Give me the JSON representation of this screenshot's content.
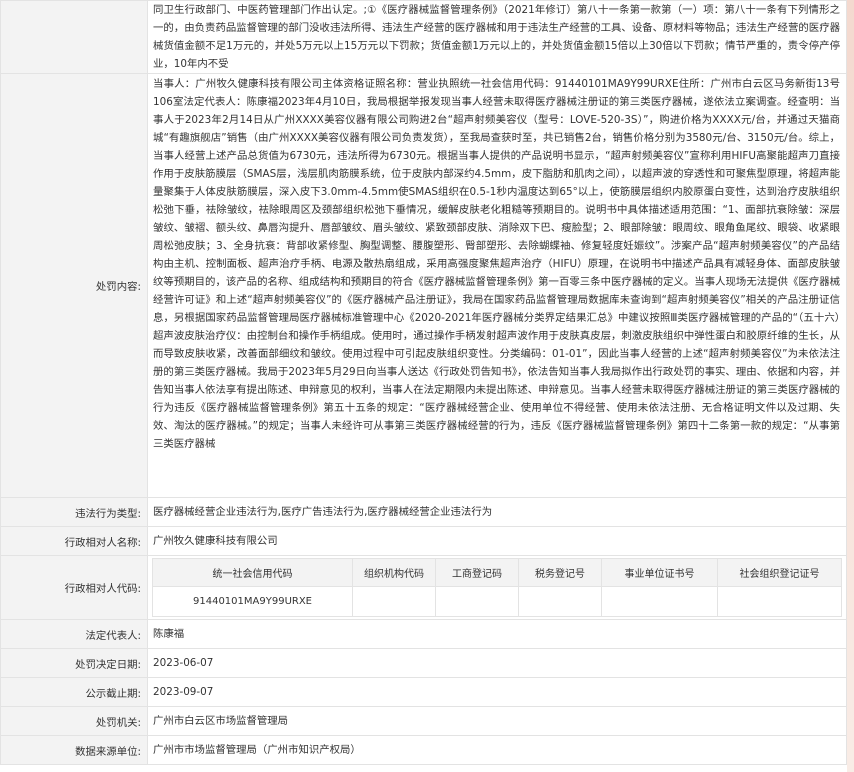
{
  "record": {
    "top_continuation": "同卫生行政部门、中医药管理部门作出认定。;①《医疗器械监督管理条例》（2021年修订）第八十一条第一款第（一）项：第八十一条有下列情形之一的，由负责药品监督管理的部门没收违法所得、违法生产经营的医疗器械和用于违法生产经营的工具、设备、原材料等物品；违法生产经营的医疗器械货值金额不足1万元的，并处5万元以上15万元以下罚款；货值金额1万元以上的，并处货值金额15倍以上30倍以下罚款；情节严重的，责令停产停业，10年内不受",
    "content_label": "处罚内容:",
    "content_text": "当事人：广州牧久健康科技有限公司主体资格证照名称：营业执照统一社会信用代码：91440101MA9Y99URXE住所：广州市白云区马务新街13号106室法定代表人：陈康福2023年4月10日，我局根据举报发现当事人经营未取得医疗器械注册证的第三类医疗器械，遂依法立案调查。经查明：当事人于2023年2月14日从广州XXXX美容仪器有限公司购进2台“超声射频美容仪（型号：LOVE-520-3S）”，购进价格为XXXX元/台，并通过天猫商城“有趣旗舰店”销售（由广州XXXX美容仪器有限公司负责发货），至我局查获时至，共已销售2台，销售价格分别为3580元/台、3150元/台。综上，当事人经营上述产品总货值为6730元，违法所得为6730元。根据当事人提供的产品说明书显示，“超声射频美容仪”宣称利用HIFU高聚能超声刀直接作用于皮肤筋膜层（SMAS层，浅层肌肉筋膜系统，位于皮肤内部深约4.5mm，皮下脂肪和肌肉之间），以超声波的穿透性和可聚焦型原理，将超声能量聚集于人体皮肤筋膜层，深入皮下3.0mm-4.5mm使SMAS组织在0.5-1秒内温度达到65°以上，使筋膜层组织内胶原蛋白变性，达到治疗皮肤组织松弛下垂，祛除皱纹，祛除眼周区及颈部组织松弛下垂情况，缓解皮肤老化粗糙等预期目的。说明书中具体描述适用范围：“1、面部抗衰除皱：深层皱纹、皱褶、额头纹、鼻唇沟提升、唇部皱纹、眉头皱纹、紧致颈部皮肤、消除双下巴、瘦脸型；2、眼部除皱：眼周纹、眼角鱼尾纹、眼袋、收紧眼周松弛皮肤；3、全身抗衰：背部收紧修型、胸型调整、腰腹塑形、臀部塑形、去除蝴蝶袖、修复轻度妊娠纹”。涉案产品“超声射频美容仪”的产品结构由主机、控制面板、超声治疗手柄、电源及散热扇组成，采用高强度聚焦超声治疗（HIFU）原理，在说明书中描述产品具有减轻身体、面部皮肤皱纹等预期目的，该产品的名称、组成结构和预期目的符合《医疗器械监督管理条例》第一百零三条中医疗器械的定义。当事人现场无法提供《医疗器械经营许可证》和上述“超声射频美容仪”的《医疗器械产品注册证》，我局在国家药品监督管理局数据库未查询到“超声射频美容仪”相关的产品注册证信息，另根据国家药品监督管理局医疗器械标准管理中心《2020-2021年医疗器械分类界定结果汇总》中建议按照Ⅲ类医疗器械管理的产品的“（五十六）超声波皮肤治疗仪：由控制台和操作手柄组成。使用时，通过操作手柄发射超声波作用于皮肤真皮层，刺激皮肤组织中弹性蛋白和胶原纤维的生长，从而导致皮肤收紧，改善面部细纹和皱纹。使用过程中可引起皮肤组织变性。分类编码：01-01”，因此当事人经营的上述“超声射频美容仪”为未依法注册的第三类医疗器械。我局于2023年5月29日向当事人送达《行政处罚告知书》，依法告知当事人我局拟作出行政处罚的事实、理由、依据和内容，并告知当事人依法享有提出陈述、申辩意见的权利，当事人在法定期限内未提出陈述、申辩意见。当事人经营未取得医疗器械注册证的第三类医疗器械的行为违反《医疗器械监督管理条例》第五十五条的规定：“医疗器械经营企业、使用单位不得经营、使用未依法注册、无合格证明文件以及过期、失效、淘汰的医疗器械。”的规定；当事人未经许可从事第三类医疗器械经营的行为，违反《医疗器械监督管理条例》第四十二条第一款的规定：“从事第三类医疗器械",
    "violation_type_label": "违法行为类型:",
    "violation_type": "医疗器械经营企业违法行为,医疗广告违法行为,医疗器械经营企业违法行为",
    "party_name_label": "行政相对人名称:",
    "party_name": "广州牧久健康科技有限公司",
    "party_code_label": "行政相对人代码:",
    "id_headers": [
      "统一社会信用代码",
      "组织机构代码",
      "工商登记码",
      "税务登记号",
      "事业单位证书号",
      "社会组织登记证号"
    ],
    "id_values": [
      "91440101MA9Y99URXE",
      "",
      "",
      "",
      "",
      ""
    ],
    "legal_rep_label": "法定代表人:",
    "legal_rep": "陈康福",
    "decision_date_label": "处罚决定日期:",
    "decision_date": "2023-06-07",
    "public_deadline_label": "公示截止期:",
    "public_deadline": "2023-09-07",
    "authority_label": "处罚机关:",
    "authority": "广州市白云区市场监督管理局",
    "source_label": "数据来源单位:",
    "source": "广州市市场监督管理局（广州市知识产权局）"
  },
  "colors": {
    "label_bg": "#f3f3f3",
    "border": "#e3e3e3",
    "text": "#333333",
    "stripe": "#f4d9cf"
  }
}
